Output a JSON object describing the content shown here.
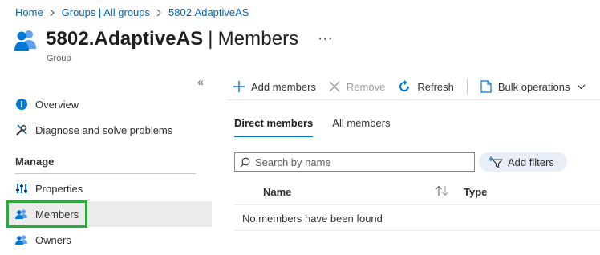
{
  "breadcrumb": {
    "items": [
      "Home",
      "Groups | All groups",
      "5802.AdaptiveAS"
    ]
  },
  "header": {
    "name": "5802.AdaptiveAS",
    "separator": "|",
    "section": "Members",
    "more": "···",
    "subtitle": "Group"
  },
  "sidebar": {
    "collapse": "«",
    "items_top": [
      {
        "label": "Overview",
        "icon": "info-icon"
      },
      {
        "label": "Diagnose and solve problems",
        "icon": "wrench-icon"
      }
    ],
    "section_label": "Manage",
    "items_manage": [
      {
        "label": "Properties",
        "icon": "properties-icon"
      },
      {
        "label": "Members",
        "icon": "members-icon",
        "active": true
      },
      {
        "label": "Owners",
        "icon": "owners-icon"
      }
    ]
  },
  "toolbar": {
    "add": "Add members",
    "remove": "Remove",
    "refresh": "Refresh",
    "bulk": "Bulk operations"
  },
  "tabs": [
    "Direct members",
    "All members"
  ],
  "search": {
    "placeholder": "Search by name"
  },
  "filters": {
    "label": "Add filters"
  },
  "table": {
    "columns": [
      "Name",
      "Type"
    ],
    "empty_message": "No members have been found"
  },
  "colors": {
    "accent": "#0078d4",
    "link": "#0067b8",
    "highlight": "#2ea83f"
  }
}
